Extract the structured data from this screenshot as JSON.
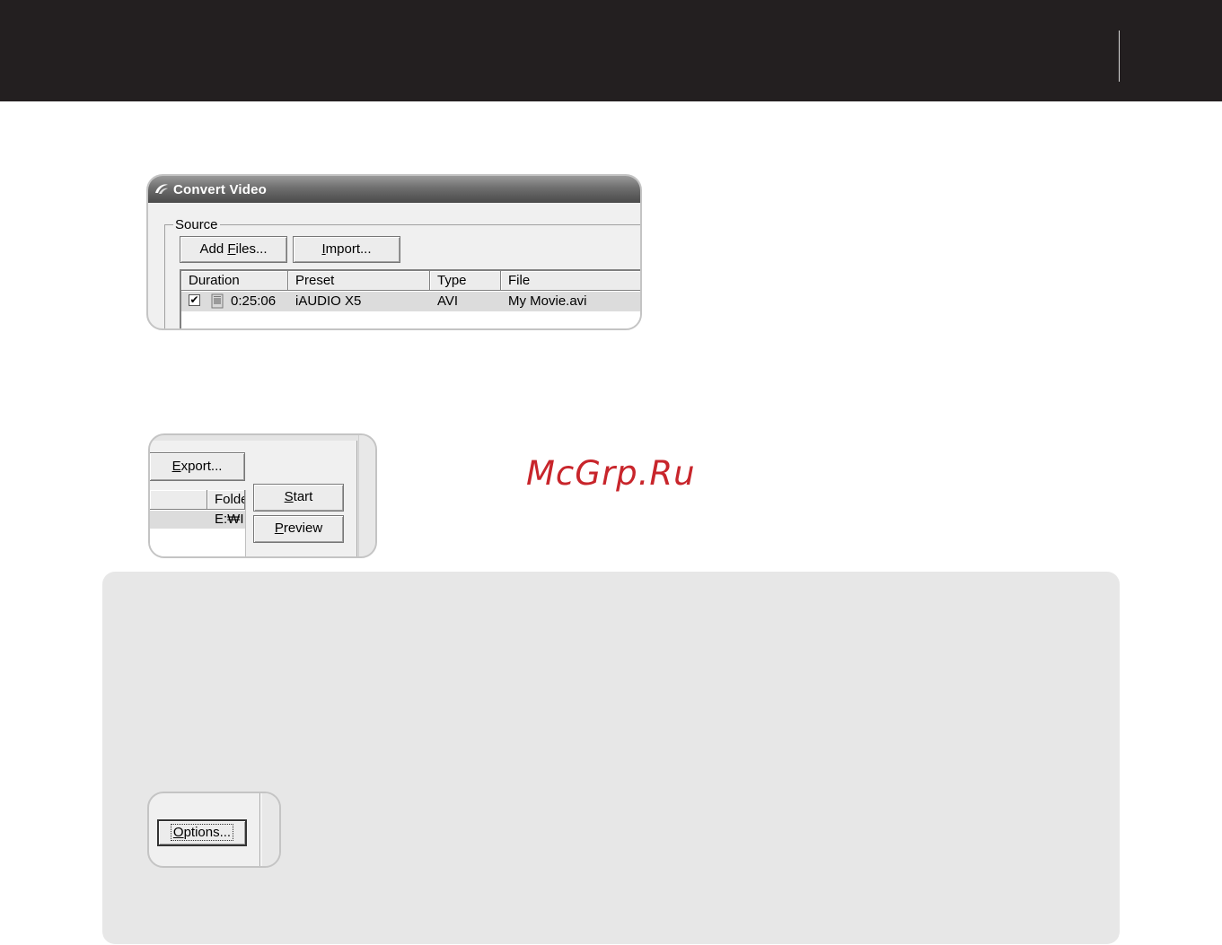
{
  "convert_video": {
    "title": "Convert Video",
    "source_label": "Source",
    "add_files_label_pre": "Add ",
    "add_files_label_u": "F",
    "add_files_label_post": "iles...",
    "import_label_u": "I",
    "import_label_post": "mport...",
    "columns": [
      "Duration",
      "Preset",
      "Type",
      "File"
    ],
    "rows": [
      {
        "checked": true,
        "duration": "0:25:06",
        "preset": "iAUDIO X5",
        "type": "AVI",
        "file": "My Movie.avi"
      }
    ]
  },
  "export_panel": {
    "export_label_u": "E",
    "export_label_post": "xport...",
    "folder_column": "Folde",
    "folder_value": "E:₩I",
    "start_label_u": "S",
    "start_label_post": "tart",
    "preview_label_u": "P",
    "preview_label_post": "review"
  },
  "options_panel": {
    "options_label_u": "O",
    "options_label_post": "ptions..."
  },
  "watermark": "McGrp.Ru",
  "colors": {
    "header_bar": "#231f20",
    "panel_bg": "#e7e7e7",
    "watermark": "#c8252b"
  }
}
